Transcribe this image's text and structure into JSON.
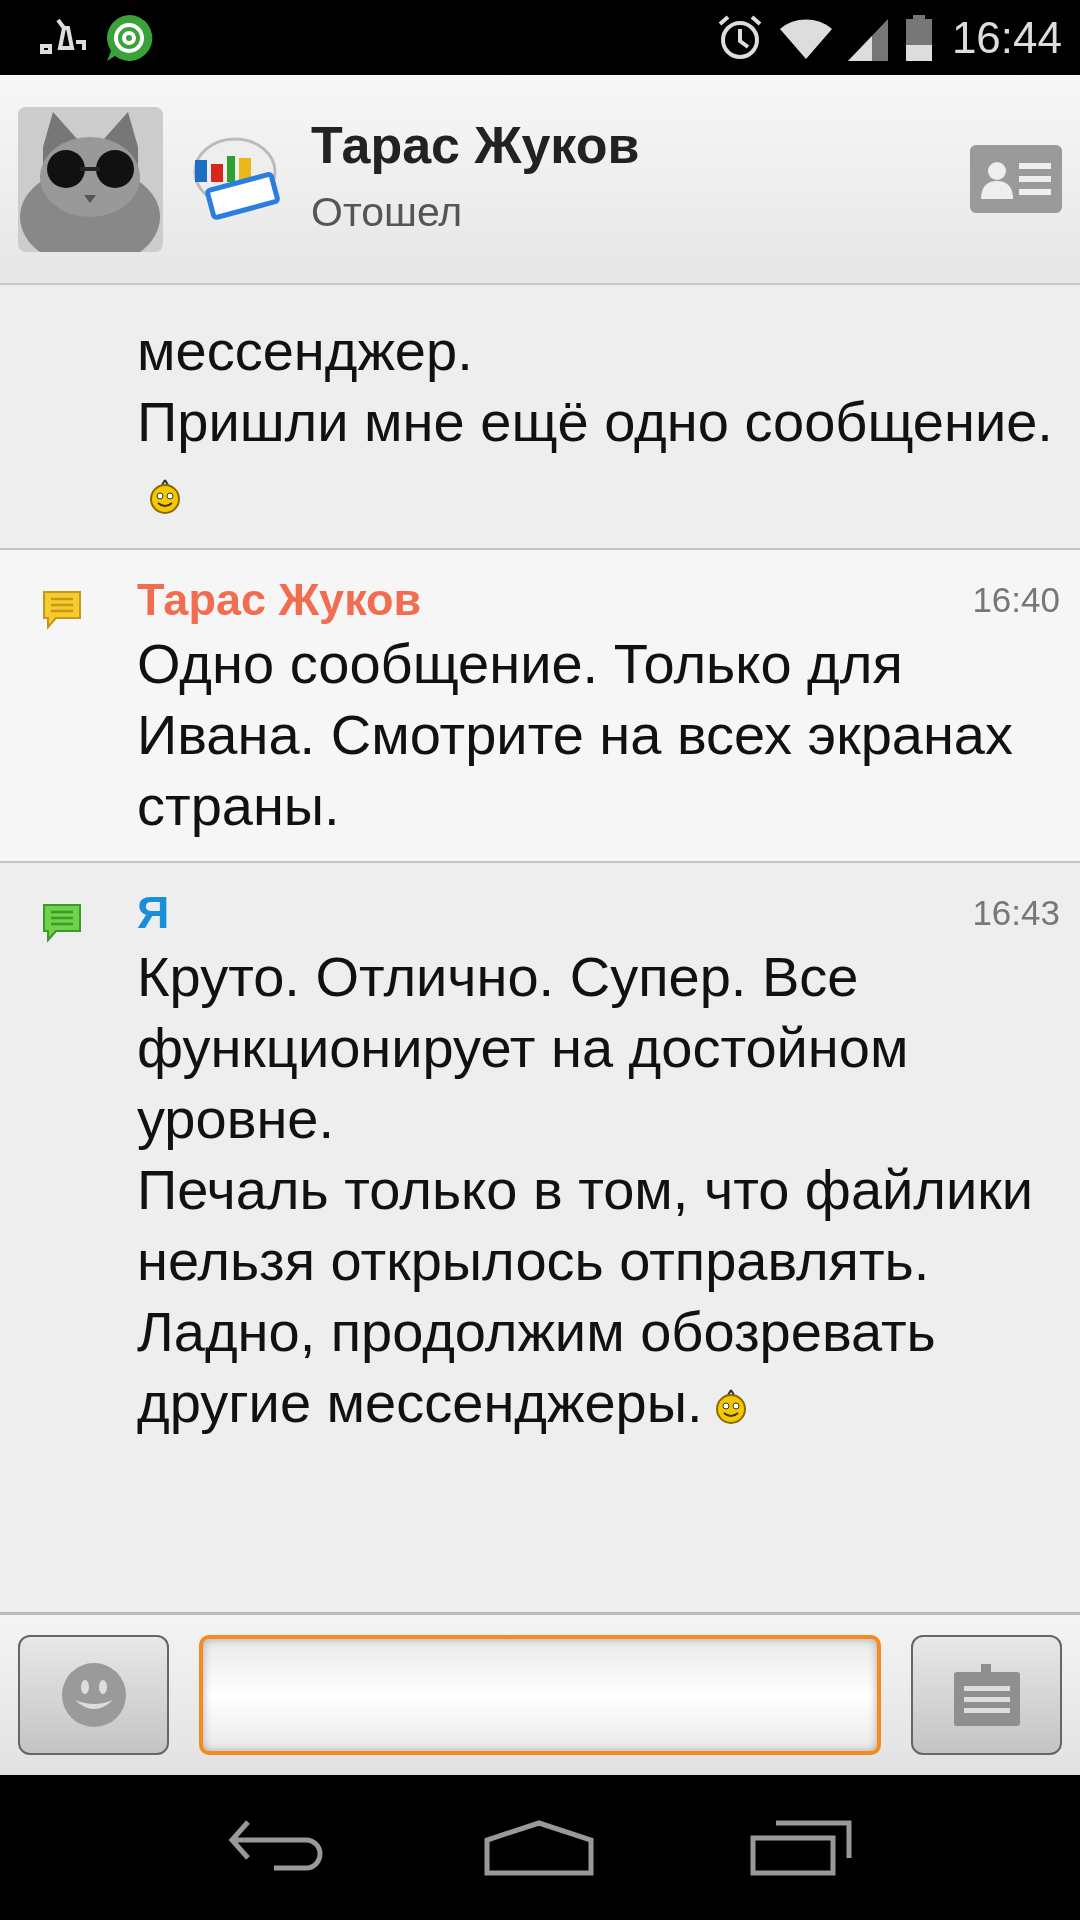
{
  "status_bar": {
    "time": "16:44"
  },
  "header": {
    "contact_name": "Тарас Жуков",
    "status": "Отошел"
  },
  "messages": [
    {
      "kind": "outgoing",
      "paragraphs": [
        "мессенджер.",
        "Пришли мне ещё одно сообщение."
      ],
      "emoticon": true
    },
    {
      "kind": "incoming",
      "sender": "Тарас Жуков",
      "time": "16:40",
      "paragraphs": [
        "Одно сообщение. Только для Ивана. Смотрите на всех экранах страны."
      ],
      "emoticon": false
    },
    {
      "kind": "outgoing",
      "sender": "Я",
      "time": "16:43",
      "paragraphs": [
        "Круто. Отлично. Супер. Все функционирует на достойном уровне.",
        "Печаль только в том, что файлики нельзя открылось отправлять.",
        "Ладно, продолжим обозревать другие мессенджеры."
      ],
      "emoticon": true
    }
  ]
}
